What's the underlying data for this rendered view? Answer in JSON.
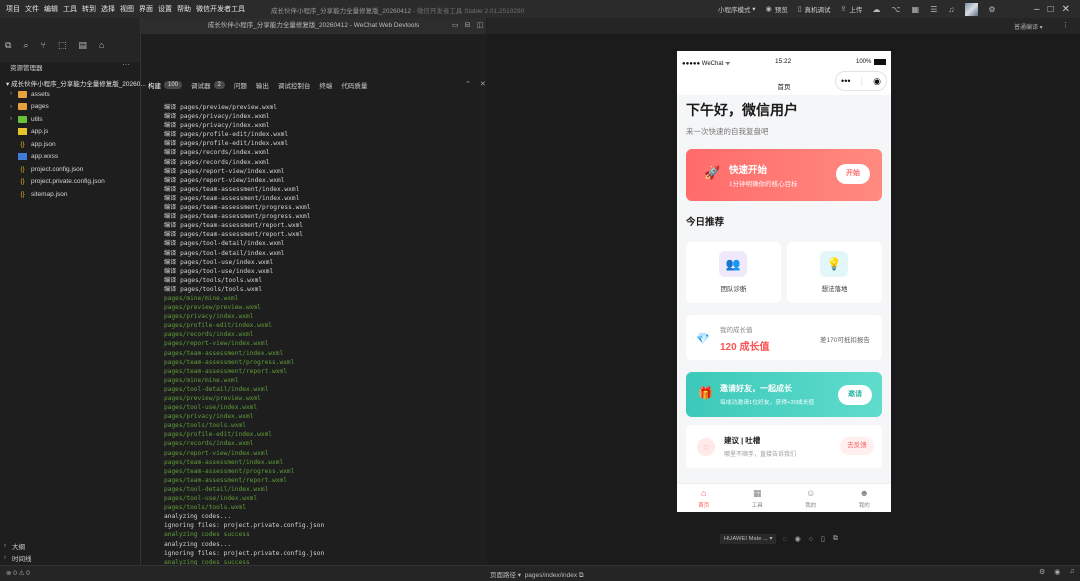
{
  "menubar": {
    "items": [
      "项目",
      "文件",
      "编辑",
      "工具",
      "转到",
      "选择",
      "视图",
      "界面",
      "设置",
      "帮助",
      "微信开发者工具"
    ],
    "window_title": "成长伙伴小程序_分享能力全量修复版_20260412",
    "version_text": " - 微信开发者工具 Stable 2.01.2510290"
  },
  "toolbar": {
    "mode_label": "小程序模式",
    "preview_label": "预览",
    "real_device_label": "真机调试",
    "upload_label": "上传",
    "compile_mode": "普通编译"
  },
  "explorer": {
    "header": "资源管理器",
    "project_root": "成长伙伴小程序_分享能力全量修复版_20260...",
    "items": [
      {
        "label": "assets",
        "type": "folder"
      },
      {
        "label": "pages",
        "type": "folder"
      },
      {
        "label": "utils",
        "type": "folder"
      },
      {
        "label": "app.js",
        "type": "js"
      },
      {
        "label": "app.json",
        "type": "json"
      },
      {
        "label": "app.wxss",
        "type": "wxss"
      },
      {
        "label": "project.config.json",
        "type": "json"
      },
      {
        "label": "project.private.config.json",
        "type": "json"
      },
      {
        "label": "sitemap.json",
        "type": "json"
      }
    ],
    "outline_label": "大纲",
    "timeline_label": "时间线"
  },
  "editor": {
    "title": "成长伙伴小程序_分享能力全量修复版_20260412 - WeChat Web Devtools"
  },
  "devtools": {
    "tabs": [
      {
        "label": "构建",
        "badge": "100"
      },
      {
        "label": "调试器",
        "badge": "2"
      },
      {
        "label": "问题",
        "badge": ""
      },
      {
        "label": "输出",
        "badge": ""
      },
      {
        "label": "调试控制台",
        "badge": ""
      },
      {
        "label": "终端",
        "badge": ""
      },
      {
        "label": "代码质量",
        "badge": ""
      }
    ],
    "console_lines": [
      {
        "text": "编译 pages/preview/preview.wxml",
        "color": "white"
      },
      {
        "text": "编译 pages/privacy/index.wxml",
        "color": "white"
      },
      {
        "text": "编译 pages/privacy/index.wxml",
        "color": "white"
      },
      {
        "text": "编译 pages/profile-edit/index.wxml",
        "color": "white"
      },
      {
        "text": "编译 pages/profile-edit/index.wxml",
        "color": "white"
      },
      {
        "text": "编译 pages/records/index.wxml",
        "color": "white"
      },
      {
        "text": "编译 pages/records/index.wxml",
        "color": "white"
      },
      {
        "text": "编译 pages/report-view/index.wxml",
        "color": "white"
      },
      {
        "text": "编译 pages/report-view/index.wxml",
        "color": "white"
      },
      {
        "text": "编译 pages/team-assessment/index.wxml",
        "color": "white"
      },
      {
        "text": "编译 pages/team-assessment/index.wxml",
        "color": "white"
      },
      {
        "text": "编译 pages/team-assessment/progress.wxml",
        "color": "white"
      },
      {
        "text": "编译 pages/team-assessment/progress.wxml",
        "color": "white"
      },
      {
        "text": "编译 pages/team-assessment/report.wxml",
        "color": "white"
      },
      {
        "text": "编译 pages/team-assessment/report.wxml",
        "color": "white"
      },
      {
        "text": "编译 pages/tool-detail/index.wxml",
        "color": "white"
      },
      {
        "text": "编译 pages/tool-detail/index.wxml",
        "color": "white"
      },
      {
        "text": "编译 pages/tool-use/index.wxml",
        "color": "white"
      },
      {
        "text": "编译 pages/tool-use/index.wxml",
        "color": "white"
      },
      {
        "text": "编译 pages/tools/tools.wxml",
        "color": "white"
      },
      {
        "text": "编译 pages/tools/tools.wxml",
        "color": "white"
      },
      {
        "text": "pages/mine/mine.wxml",
        "color": "green"
      },
      {
        "text": "pages/preview/preview.wxml",
        "color": "green"
      },
      {
        "text": "pages/privacy/index.wxml",
        "color": "green"
      },
      {
        "text": "pages/profile-edit/index.wxml",
        "color": "green"
      },
      {
        "text": "pages/records/index.wxml",
        "color": "green"
      },
      {
        "text": "pages/report-view/index.wxml",
        "color": "green"
      },
      {
        "text": "pages/team-assessment/index.wxml",
        "color": "green"
      },
      {
        "text": "pages/team-assessment/progress.wxml",
        "color": "green"
      },
      {
        "text": "pages/team-assessment/report.wxml",
        "color": "green"
      },
      {
        "text": "pages/mine/mine.wxml",
        "color": "green"
      },
      {
        "text": "pages/tool-detail/index.wxml",
        "color": "green"
      },
      {
        "text": "pages/preview/preview.wxml",
        "color": "green"
      },
      {
        "text": "pages/tool-use/index.wxml",
        "color": "green"
      },
      {
        "text": "pages/privacy/index.wxml",
        "color": "green"
      },
      {
        "text": "pages/tools/tools.wxml",
        "color": "green"
      },
      {
        "text": "pages/profile-edit/index.wxml",
        "color": "green"
      },
      {
        "text": "pages/records/index.wxml",
        "color": "green"
      },
      {
        "text": "pages/report-view/index.wxml",
        "color": "green"
      },
      {
        "text": "pages/team-assessment/index.wxml",
        "color": "green"
      },
      {
        "text": "pages/team-assessment/progress.wxml",
        "color": "green"
      },
      {
        "text": "pages/team-assessment/report.wxml",
        "color": "green"
      },
      {
        "text": "pages/tool-detail/index.wxml",
        "color": "green"
      },
      {
        "text": "pages/tool-use/index.wxml",
        "color": "green"
      },
      {
        "text": "pages/tools/tools.wxml",
        "color": "green"
      },
      {
        "text": "analyzing codes...",
        "color": "white"
      },
      {
        "text": "ignoring files: project.private.config.json",
        "color": "white"
      },
      {
        "text": "analyzing codes success",
        "color": "green"
      },
      {
        "text": "analyzing codes...",
        "color": "white"
      },
      {
        "text": "ignoring files: project.private.config.json",
        "color": "white"
      },
      {
        "text": "analyzing codes success",
        "color": "green"
      }
    ]
  },
  "phone": {
    "status": {
      "carrier": "●●●●● WeChat ᯤ",
      "time": "15:22",
      "battery": "100%"
    },
    "nav_title": "首页",
    "greeting": "下午好，微信用户",
    "greeting_sub": "来一次快速的自我复盘吧",
    "quick_start": {
      "title": "快速开始",
      "subtitle": "1分钟明确你的核心目标",
      "button": "开始"
    },
    "recommend_header": "今日推荐",
    "tools": [
      {
        "label": "团队诊断",
        "icon": "team-icon",
        "bg": "#efe9fb",
        "fg": "#6b47c9"
      },
      {
        "label": "想法落地",
        "icon": "bulb-icon",
        "bg": "#e3f7fb",
        "fg": "#f5b400"
      }
    ],
    "growth": {
      "label": "我的成长值",
      "value": "120 成长值",
      "note": "差170可抵扣报告"
    },
    "invite": {
      "title": "邀请好友，一起成长",
      "subtitle": "每成功邀请1位好友，获得+30成长值",
      "button": "邀请"
    },
    "feedback": {
      "title": "建议 | 吐槽",
      "subtitle": "哪里不顺手，直接告诉我们",
      "button": "去反馈"
    },
    "tabbar": [
      {
        "label": "首页",
        "active": true
      },
      {
        "label": "工具",
        "active": false
      },
      {
        "label": "我的",
        "active": false
      },
      {
        "label": "我的",
        "active": false
      }
    ]
  },
  "simulator": {
    "device": "HUAWEI Mate ..."
  },
  "statusbar": {
    "errors": "⊗ 0 ⚠ 0",
    "page_path_label": "页面路径",
    "page_path": "pages/index/index"
  },
  "colors": {
    "accent_red": "#ff5a5a",
    "accent_teal": "#3cc9b9",
    "console_green": "#5f9e3a"
  }
}
